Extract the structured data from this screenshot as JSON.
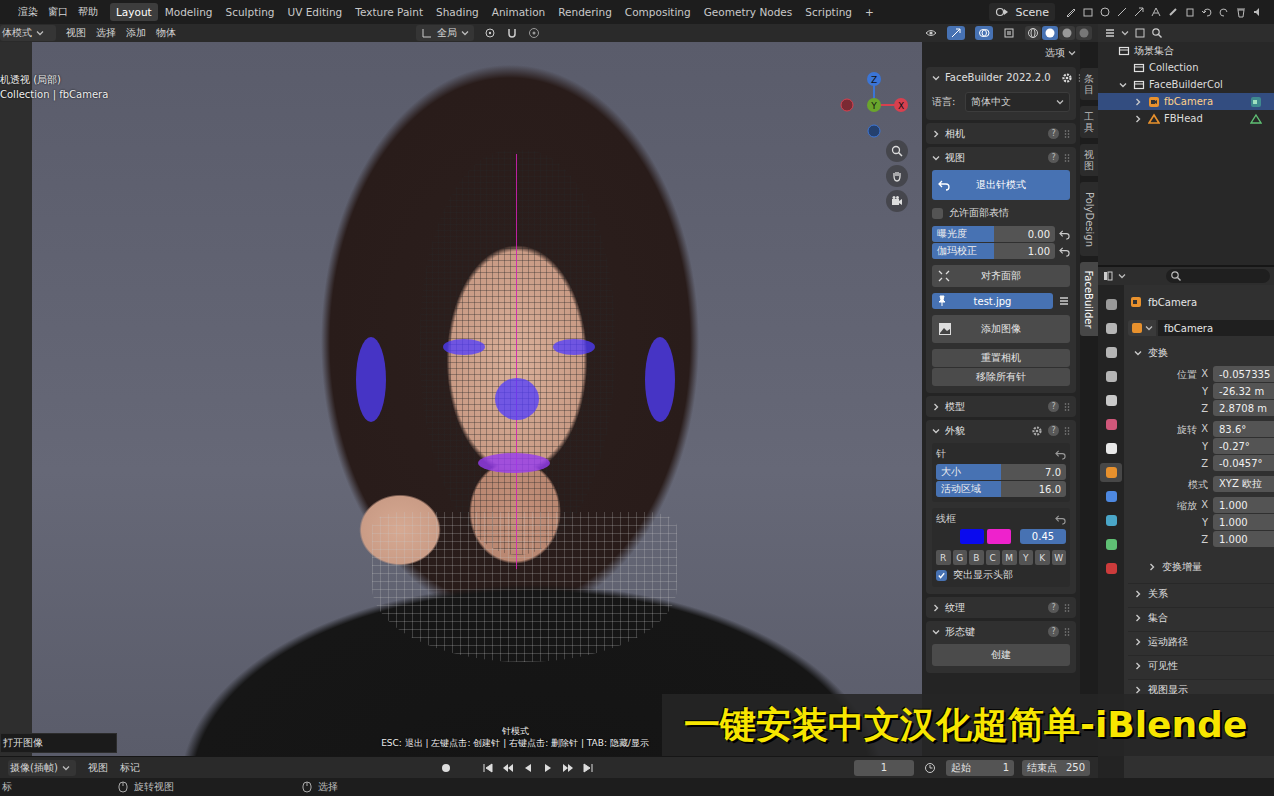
{
  "menu": [
    "渲染",
    "窗口",
    "帮助"
  ],
  "workspaces": [
    {
      "label": "Layout",
      "selected": true
    },
    {
      "label": "Modeling",
      "selected": false
    },
    {
      "label": "Sculpting",
      "selected": false
    },
    {
      "label": "UV Editing",
      "selected": false
    },
    {
      "label": "Texture Paint",
      "selected": false
    },
    {
      "label": "Shading",
      "selected": false
    },
    {
      "label": "Animation",
      "selected": false
    },
    {
      "label": "Rendering",
      "selected": false
    },
    {
      "label": "Compositing",
      "selected": false
    },
    {
      "label": "Geometry Nodes",
      "selected": false
    },
    {
      "label": "Scripting",
      "selected": false
    }
  ],
  "add_workspace": "+",
  "scene": "Scene",
  "viewport_header": {
    "mode": "体模式",
    "menus": [
      "视图",
      "选择",
      "添加",
      "物体"
    ],
    "orientation": "全局"
  },
  "viewport": {
    "view_name": "机透视 (局部)",
    "collection": "Collection | fbCamera",
    "options": "选项",
    "gizmo": [
      "X",
      "Y",
      "Z"
    ],
    "mode_title": "针模式",
    "hint": "ESC: 退出 | 左键点击: 创建针 | 右键点击: 删除针 | TAB: 隐藏/显示",
    "tooltip": "打开图像"
  },
  "sidebar_tabs": [
    {
      "label": "条目",
      "kind": "cjk",
      "selected": false
    },
    {
      "label": "工具",
      "kind": "cjk",
      "selected": false
    },
    {
      "label": "视图",
      "kind": "cjk",
      "selected": false
    },
    {
      "label": "PolyDesign",
      "kind": "latin",
      "selected": false
    },
    {
      "label": "FaceBuilder",
      "kind": "latin",
      "selected": true
    }
  ],
  "facebuilder": {
    "title": "FaceBuilder 2022.2.0",
    "help": "?",
    "language_label": "语言:",
    "language": "简体中文",
    "camera": {
      "label": "相机",
      "expanded": false
    },
    "view": {
      "label": "视图",
      "expanded": true,
      "exit_button": "退出针模式",
      "expressions": {
        "label": "允许面部表情",
        "checked": false
      },
      "sliders": [
        {
          "label": "曝光度",
          "value": "0.00",
          "level": 0.5
        },
        {
          "label": "伽玛校正",
          "value": "1.00",
          "level": 0.5
        }
      ],
      "align_button": "对齐面部",
      "image": {
        "label": "test.jpg",
        "selected": true
      },
      "add_image": "添加图像",
      "reset_camera": "重置相机",
      "remove_pins": "移除所有针"
    },
    "model": {
      "label": "模型",
      "expanded": false
    },
    "appearance": {
      "label": "外貌",
      "expanded": true,
      "pins_label": "针",
      "pin_sliders": [
        {
          "label": "大小",
          "value": "7.0",
          "level": 0.5
        },
        {
          "label": "活动区域",
          "value": "16.0",
          "level": 0.5
        }
      ],
      "wireframe_label": "线框",
      "wire_colors": [
        {
          "color": "#0a0aee"
        },
        {
          "color": "#ee22cc"
        }
      ],
      "wire_opacity": "0.45",
      "channels": [
        "R",
        "G",
        "B",
        "C",
        "M",
        "Y",
        "K",
        "W"
      ],
      "highlight_head": {
        "label": "突出显示头部",
        "checked": true
      }
    },
    "texture": {
      "label": "纹理",
      "expanded": false
    },
    "shape_keys": {
      "label": "形态键",
      "expanded": true,
      "create_button": "创建"
    }
  },
  "outliner": {
    "items": [
      {
        "label": "场景集合",
        "depth": 0,
        "kind": "scene",
        "expandable": false,
        "expanded": true,
        "selected": false
      },
      {
        "label": "Collection",
        "depth": 1,
        "kind": "collection",
        "expandable": false,
        "expanded": false,
        "selected": false
      },
      {
        "label": "FaceBuilderCol",
        "depth": 1,
        "kind": "collection",
        "expandable": true,
        "expanded": true,
        "selected": false
      },
      {
        "label": "fbCamera",
        "depth": 2,
        "kind": "camera",
        "expandable": true,
        "expanded": false,
        "selected": true
      },
      {
        "label": "FBHead",
        "depth": 2,
        "kind": "mesh",
        "expandable": true,
        "expanded": false,
        "selected": false
      }
    ]
  },
  "properties": {
    "tabs": [
      {
        "color": "#9a9a9a",
        "selected": false
      },
      {
        "color": "#b5b5b5",
        "selected": false
      },
      {
        "color": "#b5b5b5",
        "selected": false
      },
      {
        "color": "#b5b5b5",
        "selected": false
      },
      {
        "color": "#c9c9c9",
        "selected": false
      },
      {
        "color": "#d0577a",
        "selected": false
      },
      {
        "color": "#e8e8e8",
        "selected": false
      },
      {
        "color": "#e8912d",
        "selected": true
      },
      {
        "color": "#4d88e0",
        "selected": false
      },
      {
        "color": "#4aa6c8",
        "selected": false
      },
      {
        "color": "#5fc074",
        "selected": false
      },
      {
        "color": "#cc3b3b",
        "selected": false
      }
    ],
    "object": "fbCamera",
    "datablock": "fbCamera",
    "transform": {
      "label": "变换",
      "expanded": true,
      "vectors": [
        {
          "label": "位置",
          "rows": [
            {
              "axis": "X",
              "value": "-0.057335"
            },
            {
              "axis": "Y",
              "value": "-26.32 m"
            },
            {
              "axis": "Z",
              "value": "2.8708 m"
            }
          ]
        },
        {
          "label": "旋转",
          "rows": [
            {
              "axis": "X",
              "value": "83.6°"
            },
            {
              "axis": "Y",
              "value": "-0.27°"
            },
            {
              "axis": "Z",
              "value": "-0.0457°"
            }
          ]
        }
      ],
      "mode_label": "模式",
      "mode": "XYZ 欧拉",
      "scale": {
        "label": "缩放",
        "rows": [
          {
            "axis": "X",
            "value": "1.000"
          },
          {
            "axis": "Y",
            "value": "1.000"
          },
          {
            "axis": "Z",
            "value": "1.000"
          }
        ]
      },
      "delta": {
        "label": "变换增量",
        "expanded": false
      }
    },
    "sections": [
      {
        "label": "关系",
        "expanded": false
      },
      {
        "label": "集合",
        "expanded": false
      },
      {
        "label": "运动路径",
        "expanded": false
      },
      {
        "label": "可见性",
        "expanded": false
      },
      {
        "label": "视图显示",
        "expanded": false
      }
    ]
  },
  "timeline": {
    "mode": "摄像(插帧)",
    "menus": [
      "视图",
      "标记"
    ],
    "frame": "1",
    "start_label": "起始",
    "start": "1",
    "end_label": "结束点",
    "end": "250"
  },
  "status_bar": {
    "items": [
      {
        "label": "标",
        "kind": "text"
      },
      {
        "label": "旋转视图",
        "kind": "mouse"
      },
      {
        "label": "选择",
        "kind": "mouse"
      }
    ]
  },
  "watermark": "一键安装中文汉化超简单-iBlende"
}
